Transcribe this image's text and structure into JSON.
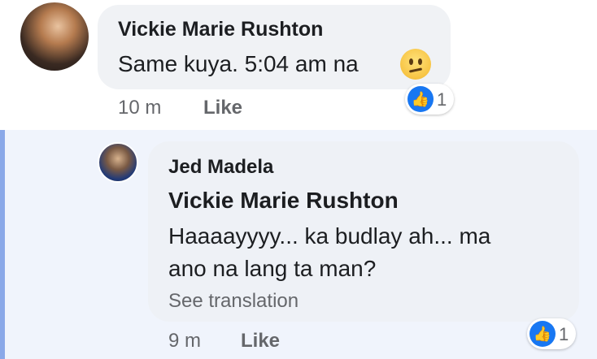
{
  "comment": {
    "author": "Vickie Marie Rushton",
    "text": "Same kuya. 5:04 am na",
    "emoji_icon": "confused-face-icon",
    "time": "10 m",
    "like_label": "Like",
    "reaction_count": "1"
  },
  "reply": {
    "author": "Jed Madela",
    "mention": "Vickie Marie Rushton",
    "line1": "Haaaayyyy... ka budlay ah... ma",
    "line2": "ano na lang ta man?",
    "see_translation": "See translation",
    "time": "9 m",
    "like_label": "Like",
    "reaction_count": "1"
  },
  "colors": {
    "accent": "#1877f2",
    "reply_bar": "#8aa8e8",
    "reply_background": "#f0f4fc",
    "bubble": "#f0f2f5"
  }
}
